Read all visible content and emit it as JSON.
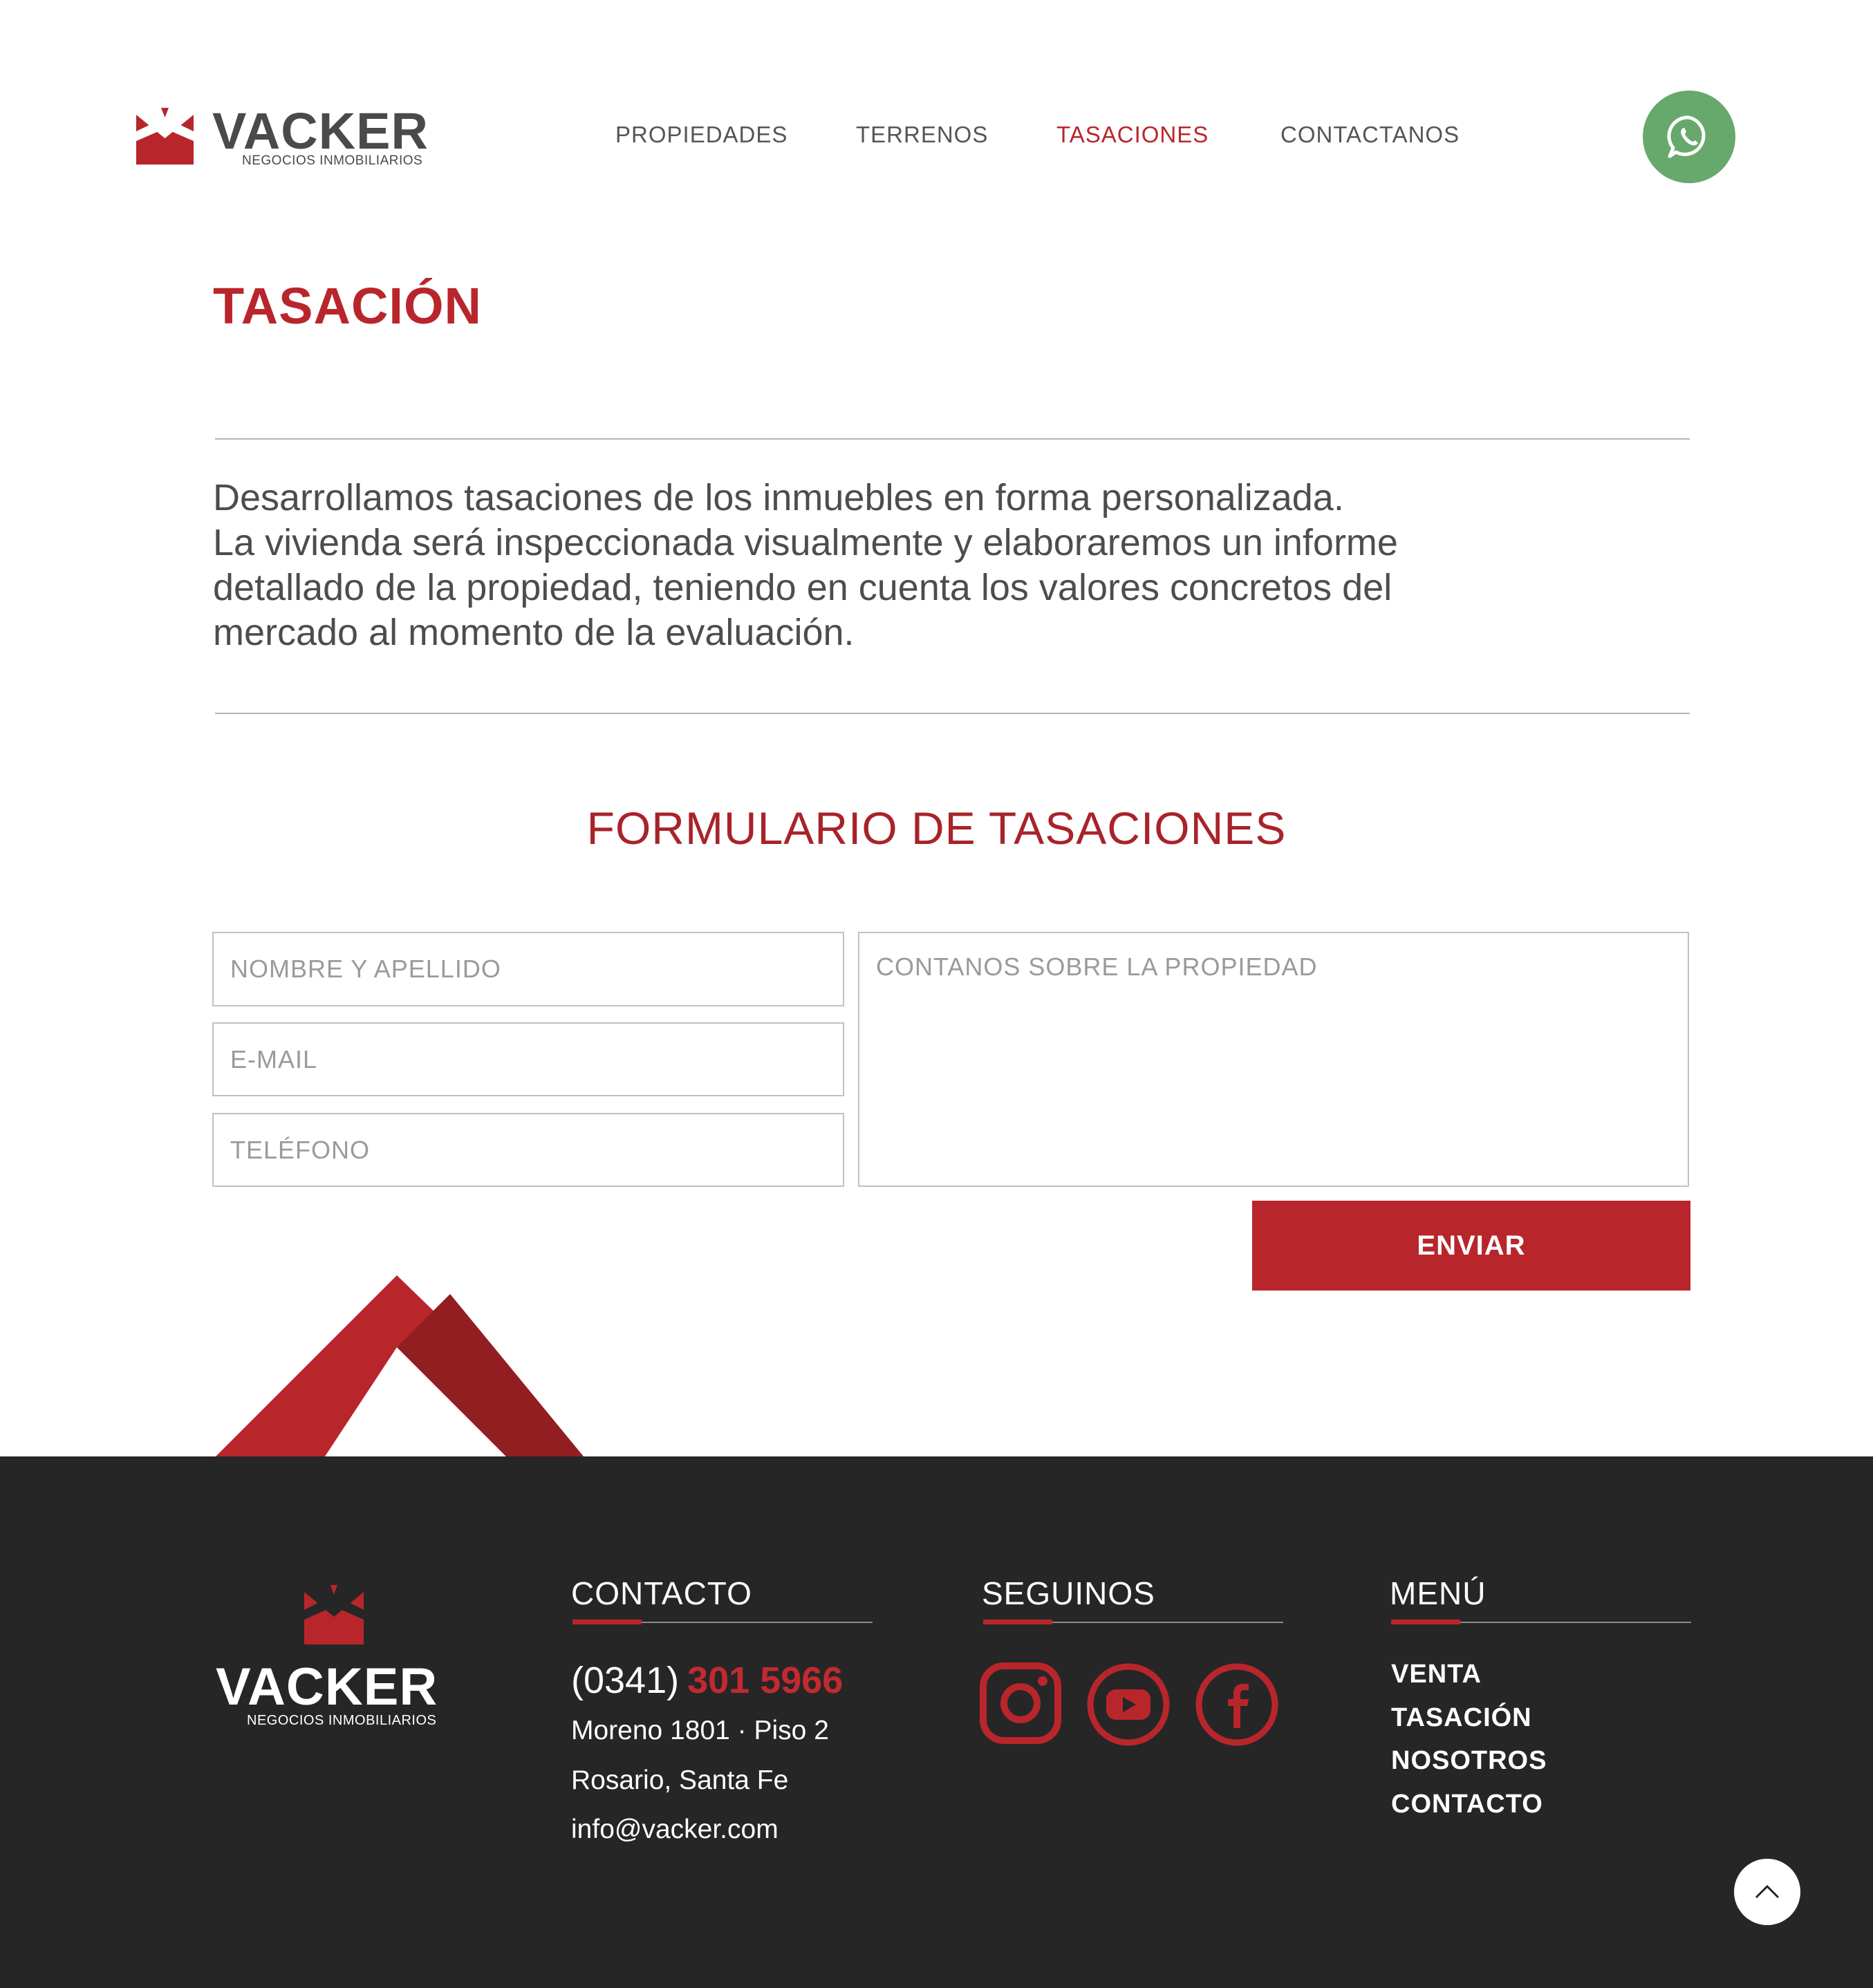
{
  "header": {
    "logo_name": "VACKER",
    "logo_sub": "NEGOCIOS INMOBILIARIOS",
    "nav": [
      "PROPIEDADES",
      "TERRENOS",
      "TASACIONES",
      "CONTACTANOS"
    ],
    "active_nav": "TASACIONES"
  },
  "page": {
    "title": "TASACIÓN",
    "intro_lines": [
      "Desarrollamos tasaciones de los inmuebles en forma personalizada.",
      "La vivienda será inspeccionada visualmente y elaboraremos un informe",
      "detallado de la propiedad, teniendo en cuenta los valores concretos del",
      "mercado al momento de la evaluación."
    ]
  },
  "form": {
    "title": "FORMULARIO DE TASACIONES",
    "name_placeholder": "NOMBRE Y APELLIDO",
    "email_placeholder": "E-MAIL",
    "phone_placeholder": "TELÉFONO",
    "message_placeholder": "CONTANOS SOBRE LA PROPIEDAD",
    "submit_label": "ENVIAR"
  },
  "footer": {
    "logo_name": "VACKER",
    "logo_sub": "NEGOCIOS INMOBILIARIOS",
    "contact_heading": "CONTACTO",
    "phone_prefix": "(0341)",
    "phone_number": "301 5966",
    "address": "Moreno 1801 · Piso 2",
    "city": "Rosario, Santa Fe",
    "email": "info@vacker.com",
    "social_heading": "SEGUINOS",
    "social": [
      "instagram-icon",
      "youtube-icon",
      "facebook-icon"
    ],
    "menu_heading": "MENÚ",
    "menu": [
      "VENTA",
      "TASACIÓN",
      "NOSOTROS",
      "CONTACTO"
    ]
  },
  "colors": {
    "brand_red": "#b8262c",
    "dark_red": "#921e22",
    "whatsapp_green": "#67a86c",
    "footer_bg": "#262626",
    "text_gray": "#4a4a4a"
  }
}
